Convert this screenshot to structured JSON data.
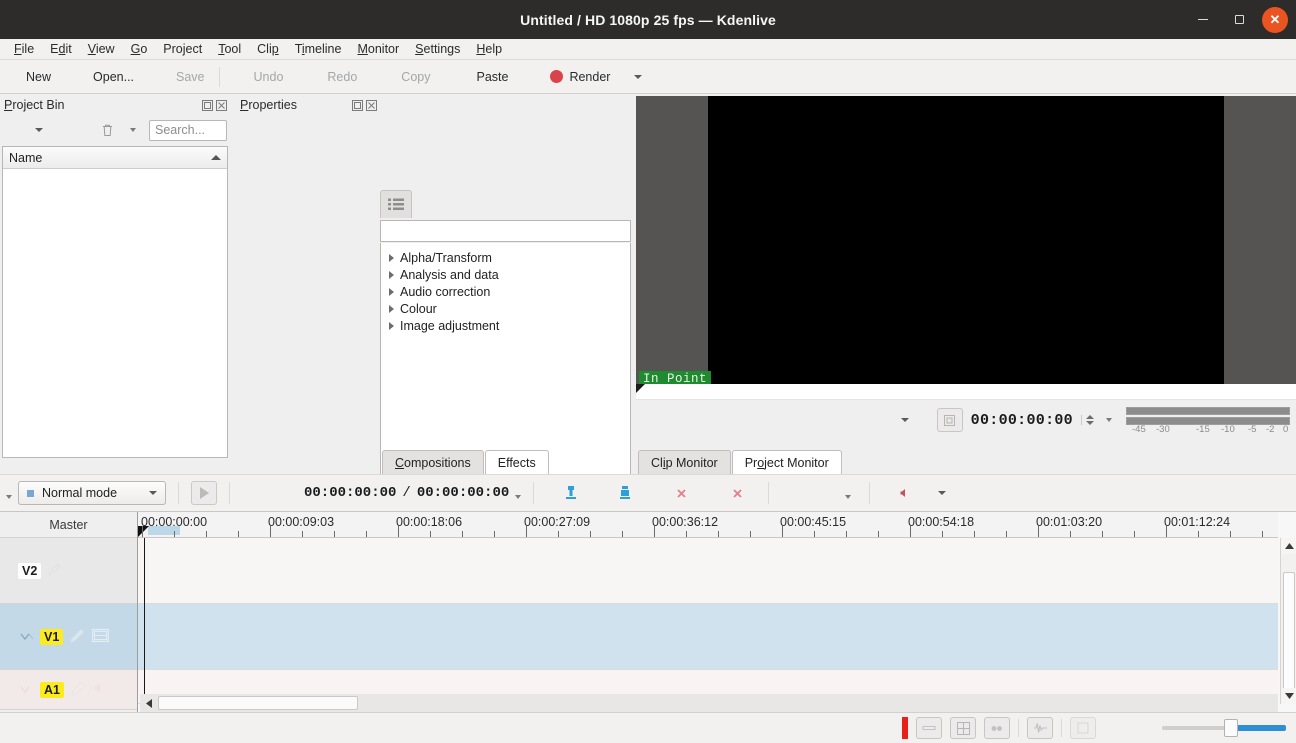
{
  "window": {
    "title": "Untitled / HD 1080p 25 fps — Kdenlive",
    "minimize_label": "Minimize",
    "maximize_label": "Restore",
    "close_label": "Close"
  },
  "menubar": {
    "items": [
      {
        "label": "File"
      },
      {
        "label": "Edit"
      },
      {
        "label": "View"
      },
      {
        "label": "Go"
      },
      {
        "label": "Project"
      },
      {
        "label": "Tool"
      },
      {
        "label": "Clip"
      },
      {
        "label": "Timeline"
      },
      {
        "label": "Monitor"
      },
      {
        "label": "Settings"
      },
      {
        "label": "Help"
      }
    ]
  },
  "toolbar": {
    "new_label": "New",
    "open_label": "Open...",
    "save_label": "Save",
    "undo_label": "Undo",
    "redo_label": "Redo",
    "copy_label": "Copy",
    "paste_label": "Paste",
    "render_label": "Render",
    "render_dot_color": "#d9434c"
  },
  "project_bin": {
    "title": "Project Bin",
    "search_placeholder": "Search...",
    "column_name": "Name",
    "items": []
  },
  "properties": {
    "title": "Properties"
  },
  "effects": {
    "search_value": "",
    "categories": [
      {
        "label": "Alpha/Transform"
      },
      {
        "label": "Analysis and data"
      },
      {
        "label": "Audio correction"
      },
      {
        "label": "Colour"
      },
      {
        "label": "Image adjustment"
      }
    ],
    "tabs": [
      {
        "label": "Compositions",
        "active": false
      },
      {
        "label": "Effects",
        "active": true
      }
    ]
  },
  "monitor": {
    "in_point_label": "In Point",
    "timecode": "00:00:00:00",
    "tabs": [
      {
        "label": "Clip Monitor",
        "active": false
      },
      {
        "label": "Project Monitor",
        "active": true
      }
    ],
    "audio_meter_ticks": [
      "-45",
      "-30",
      "-15",
      "-10",
      "-5",
      "-2",
      "0"
    ]
  },
  "timeline_toolbar": {
    "edit_mode": "Normal mode",
    "position_timecode": "00:00:00:00",
    "duration_timecode": "00:00:00:00",
    "separator": "/"
  },
  "timeline": {
    "master_label": "Master",
    "ruler_labels": [
      "00:00:00:00",
      "00:00:09:03",
      "00:00:18:06",
      "00:00:27:09",
      "00:00:36:12",
      "00:00:45:15",
      "00:00:54:18",
      "00:01:03:20",
      "00:01:12:24"
    ],
    "tracks": [
      {
        "name": "V2",
        "highlight": false,
        "kind": "video"
      },
      {
        "name": "V1",
        "highlight": true,
        "kind": "video"
      },
      {
        "name": "A1",
        "highlight": true,
        "kind": "audio"
      }
    ]
  },
  "statusbar": {
    "record_color": "#e8201a",
    "zoom_value": 50
  }
}
